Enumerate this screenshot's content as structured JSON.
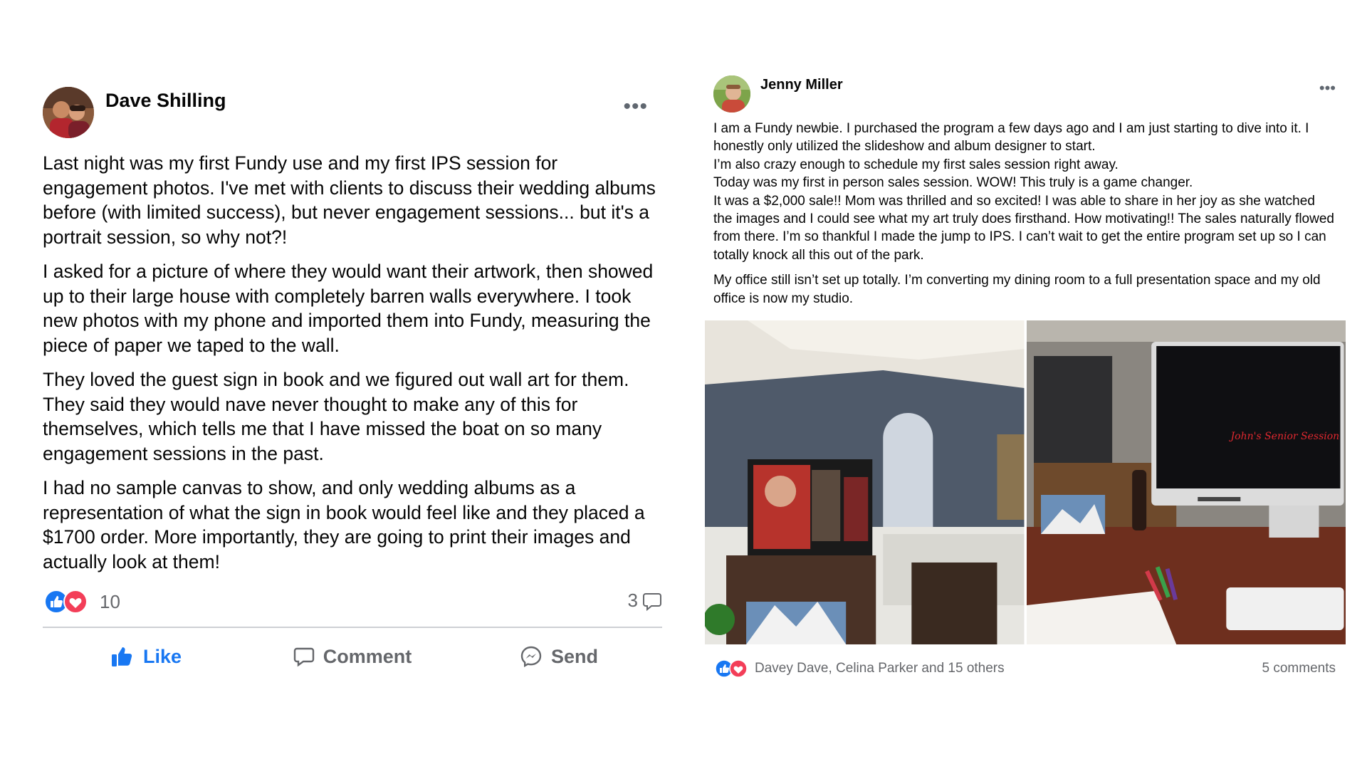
{
  "left_post": {
    "author": "Dave Shilling",
    "more_label": "•••",
    "paragraphs": [
      "Last night was my first Fundy use and my first IPS session for engagement photos. I've met with clients to discuss their wedding albums before (with limited success), but never engagement sessions... but it's a portrait session, so why not?!",
      "I  asked for a picture of where they would want their artwork, then showed up to their large house with completely barren walls everywhere. I took new photos with my phone and imported them into Fundy, measuring the piece of paper we taped to the wall.",
      "They loved the guest sign in book and we figured out wall art for them. They said they would nave never thought to make any of this for themselves, which tells me that I have missed the boat on so many engagement sessions in the past.",
      "I had no sample canvas to show, and only wedding albums as a representation of what the sign in book would feel like and they placed a $1700 order. More importantly, they are going to print their images and actually look at them!"
    ],
    "reaction_count": "10",
    "comment_count": "3",
    "actions": {
      "like": "Like",
      "comment": "Comment",
      "send": "Send"
    }
  },
  "right_post": {
    "author": "Jenny Miller",
    "more_label": "•••",
    "paragraphs": [
      "I am a Fundy newbie. I purchased the program a few days ago and I am just starting to dive into it. I honestly only utilized the slideshow and album designer to start.\nI’m also crazy enough to schedule my first sales session right away.\nToday was my first in person sales session. WOW! This truly is a game changer.\nIt was a $2,000 sale!! Mom was thrilled and so excited! I was able to share in her joy as she watched the images and I could see what my art truly does firsthand. How motivating!! The sales naturally flowed from there. I’m so thankful I made the jump to IPS. I can’t wait to get the entire program set up so I can totally knock all this out of the park.",
      "My office still isn’t set up totally. I’m converting my dining room to a full presentation space and my old office is now my studio."
    ],
    "photo_screen_text": "John's Senior Session",
    "reactors": "Davey Dave, Celina Parker and 15 others",
    "comments": "5 comments"
  },
  "colors": {
    "like_blue": "#1877f2",
    "love_red": "#f33e58",
    "secondary_text": "#65676b"
  },
  "icons": [
    "like-reaction-icon",
    "love-reaction-icon",
    "comment-bubble-icon",
    "thumbs-up-icon",
    "messenger-icon",
    "more-icon"
  ]
}
